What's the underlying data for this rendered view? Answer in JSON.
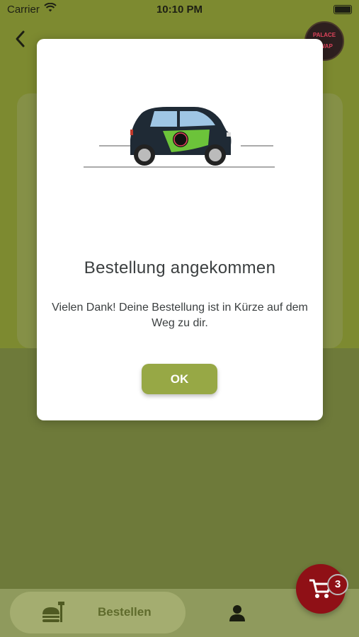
{
  "status_bar": {
    "carrier": "Carrier",
    "time": "10:10 PM"
  },
  "header": {
    "back_icon": "chevron-left-icon",
    "logo_text_top": "PALACE",
    "logo_text_bottom": "SWAP"
  },
  "modal": {
    "illustration": "delivery-car-icon",
    "title": "Bestellung angekommen",
    "message": "Vielen Dank! Deine Bestellung ist in Kürze auf dem Weg zu dir.",
    "ok_label": "OK"
  },
  "tabbar": {
    "order_label": "Bestellen",
    "order_icon": "food-icon",
    "profile_icon": "person-icon"
  },
  "cart": {
    "icon": "cart-icon",
    "count": "3"
  },
  "colors": {
    "accent": "#97a845",
    "cart": "#8f1016"
  }
}
